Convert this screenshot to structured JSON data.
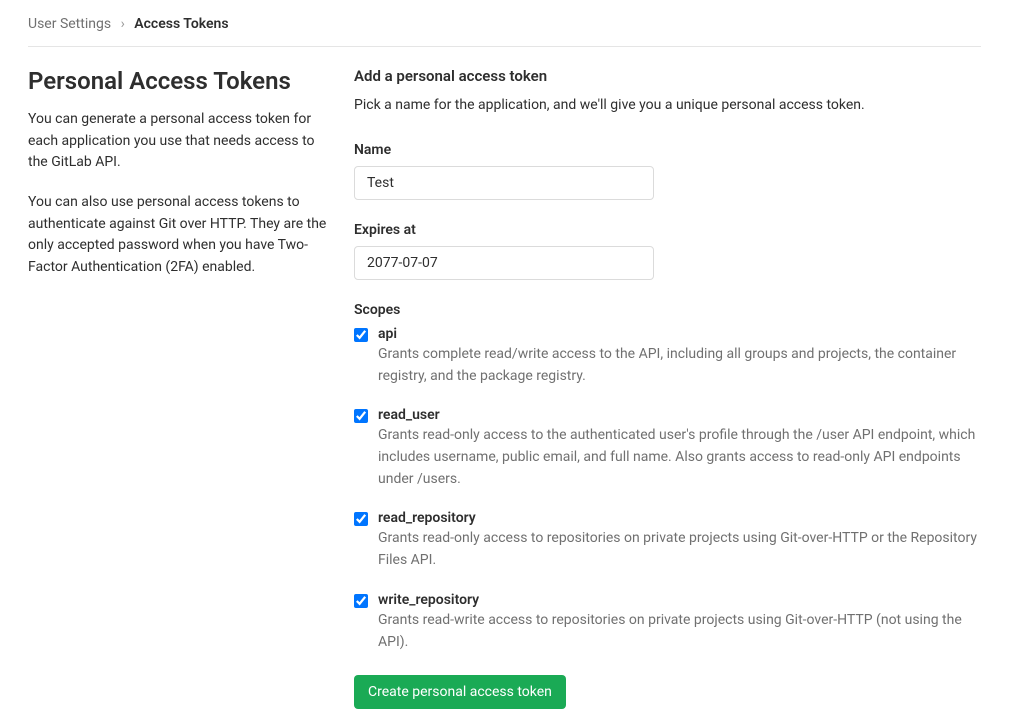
{
  "breadcrumb": {
    "parent": "User Settings",
    "current": "Access Tokens"
  },
  "sidebar": {
    "title": "Personal Access Tokens",
    "paragraph1": "You can generate a personal access token for each application you use that needs access to the GitLab API.",
    "paragraph2": "You can also use personal access tokens to authenticate against Git over HTTP. They are the only accepted password when you have Two-Factor Authentication (2FA) enabled."
  },
  "form": {
    "title": "Add a personal access token",
    "subtitle": "Pick a name for the application, and we'll give you a unique personal access token.",
    "name_label": "Name",
    "name_value": "Test",
    "expires_label": "Expires at",
    "expires_value": "2077-07-07",
    "scopes_label": "Scopes",
    "submit_label": "Create personal access token"
  },
  "scopes": [
    {
      "name": "api",
      "checked": true,
      "description": "Grants complete read/write access to the API, including all groups and projects, the container registry, and the package registry."
    },
    {
      "name": "read_user",
      "checked": true,
      "description": "Grants read-only access to the authenticated user's profile through the /user API endpoint, which includes username, public email, and full name. Also grants access to read-only API endpoints under /users."
    },
    {
      "name": "read_repository",
      "checked": true,
      "description": "Grants read-only access to repositories on private projects using Git-over-HTTP or the Repository Files API."
    },
    {
      "name": "write_repository",
      "checked": true,
      "description": "Grants read-write access to repositories on private projects using Git-over-HTTP (not using the API)."
    }
  ]
}
